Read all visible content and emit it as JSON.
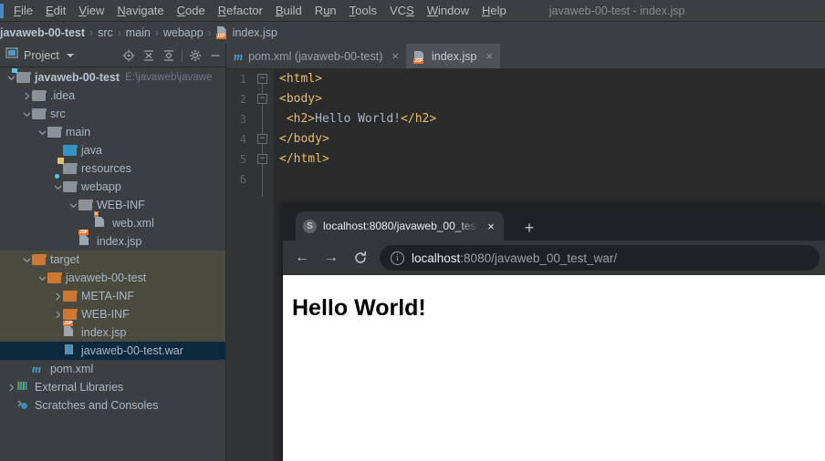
{
  "ide": {
    "window_title": "javaweb-00-test - index.jsp",
    "menu_items": [
      {
        "label": "File",
        "mnemonic": "F"
      },
      {
        "label": "Edit",
        "mnemonic": "E"
      },
      {
        "label": "View",
        "mnemonic": "V"
      },
      {
        "label": "Navigate",
        "mnemonic": "N"
      },
      {
        "label": "Code",
        "mnemonic": "C"
      },
      {
        "label": "Refactor",
        "mnemonic": "R"
      },
      {
        "label": "Build",
        "mnemonic": "B"
      },
      {
        "label": "Run",
        "mnemonic": "u"
      },
      {
        "label": "Tools",
        "mnemonic": "T"
      },
      {
        "label": "VCS",
        "mnemonic": "S"
      },
      {
        "label": "Window",
        "mnemonic": "W"
      },
      {
        "label": "Help",
        "mnemonic": "H"
      }
    ],
    "breadcrumb": {
      "items": [
        "javaweb-00-test",
        "src",
        "main",
        "webapp",
        "index.jsp"
      ],
      "separator": "›"
    },
    "project_panel": {
      "title": "Project",
      "toolbar_icons": [
        "locate-icon",
        "expand-all-icon",
        "collapse-all-icon",
        "settings-gear-icon",
        "hide-icon"
      ],
      "tree": [
        {
          "label": "javaweb-00-test",
          "sub": "E:\\javaweb\\javawe",
          "depth": 0,
          "arrow": "down",
          "icon": "module-folder",
          "bold": true,
          "state": "normal"
        },
        {
          "label": ".idea",
          "sub": "",
          "depth": 1,
          "arrow": "right",
          "icon": "folder-grey",
          "bold": false,
          "state": "normal"
        },
        {
          "label": "src",
          "sub": "",
          "depth": 1,
          "arrow": "down",
          "icon": "folder-grey",
          "bold": false,
          "state": "normal"
        },
        {
          "label": "main",
          "sub": "",
          "depth": 2,
          "arrow": "down",
          "icon": "folder-grey",
          "bold": false,
          "state": "normal"
        },
        {
          "label": "java",
          "sub": "",
          "depth": 3,
          "arrow": "none",
          "icon": "folder-blue",
          "bold": false,
          "state": "normal"
        },
        {
          "label": "resources",
          "sub": "",
          "depth": 3,
          "arrow": "none",
          "icon": "folder-resources",
          "bold": false,
          "state": "normal"
        },
        {
          "label": "webapp",
          "sub": "",
          "depth": 3,
          "arrow": "down",
          "icon": "folder-webapp",
          "bold": false,
          "state": "normal"
        },
        {
          "label": "WEB-INF",
          "sub": "",
          "depth": 4,
          "arrow": "down",
          "icon": "folder-grey",
          "bold": false,
          "state": "normal"
        },
        {
          "label": "web.xml",
          "sub": "",
          "depth": 5,
          "arrow": "none",
          "icon": "xml-file",
          "bold": false,
          "state": "normal"
        },
        {
          "label": "index.jsp",
          "sub": "",
          "depth": 4,
          "arrow": "none",
          "icon": "jsp-file",
          "bold": false,
          "state": "normal"
        },
        {
          "label": "target",
          "sub": "",
          "depth": 1,
          "arrow": "down",
          "icon": "folder-orange",
          "bold": false,
          "state": "excluded"
        },
        {
          "label": "javaweb-00-test",
          "sub": "",
          "depth": 2,
          "arrow": "down",
          "icon": "folder-orange",
          "bold": false,
          "state": "excluded"
        },
        {
          "label": "META-INF",
          "sub": "",
          "depth": 3,
          "arrow": "right",
          "icon": "folder-orange",
          "bold": false,
          "state": "excluded"
        },
        {
          "label": "WEB-INF",
          "sub": "",
          "depth": 3,
          "arrow": "right",
          "icon": "folder-orange",
          "bold": false,
          "state": "excluded"
        },
        {
          "label": "index.jsp",
          "sub": "",
          "depth": 3,
          "arrow": "none",
          "icon": "jsp-file",
          "bold": false,
          "state": "excluded"
        },
        {
          "label": "javaweb-00-test.war",
          "sub": "",
          "depth": 3,
          "arrow": "none",
          "icon": "war-archive",
          "bold": false,
          "state": "selected"
        },
        {
          "label": "pom.xml",
          "sub": "",
          "depth": 1,
          "arrow": "none",
          "icon": "maven-file",
          "bold": false,
          "state": "normal"
        },
        {
          "label": "External Libraries",
          "sub": "",
          "depth": 0,
          "arrow": "right",
          "icon": "libraries",
          "bold": false,
          "state": "normal"
        },
        {
          "label": "Scratches and Consoles",
          "sub": "",
          "depth": 0,
          "arrow": "none",
          "icon": "scratches",
          "bold": false,
          "state": "normal"
        }
      ]
    },
    "editor": {
      "tabs": [
        {
          "label": "pom.xml (javaweb-00-test)",
          "icon": "maven-file",
          "active": false,
          "close": "×"
        },
        {
          "label": "index.jsp",
          "icon": "jsp-file",
          "active": true,
          "close": "×"
        }
      ],
      "line_numbers": [
        "1",
        "2",
        "3",
        "4",
        "5",
        "6"
      ],
      "lines": [
        {
          "pre": "",
          "tag1": "<html>",
          "text": "",
          "tag2": ""
        },
        {
          "pre": "",
          "tag1": "<body>",
          "text": "",
          "tag2": ""
        },
        {
          "pre": " ",
          "tag1": "<h2>",
          "text": "Hello World!",
          "tag2": "</h2>"
        },
        {
          "pre": "",
          "tag1": "</body>",
          "text": "",
          "tag2": ""
        },
        {
          "pre": "",
          "tag1": "</html>",
          "text": "",
          "tag2": ""
        },
        {
          "pre": "",
          "tag1": "",
          "text": "",
          "tag2": ""
        }
      ]
    }
  },
  "browser": {
    "tab": {
      "title": "localhost:8080/javaweb_00_tes",
      "favicon": "globe-icon",
      "close": "×"
    },
    "new_tab_label": "+",
    "nav": {
      "back": "←",
      "forward": "→",
      "reload": "⟳"
    },
    "omnibox": {
      "info_icon": "i",
      "url_host": "localhost",
      "url_rest": ":8080/javaweb_00_test_war/"
    },
    "page": {
      "heading": "Hello World!"
    }
  },
  "colors": {
    "ide_bg": "#3c3f41",
    "editor_bg": "#2b2b2b",
    "gutter_bg": "#313335",
    "accent_orange": "#cc7832",
    "tag_yellow": "#e8bf6a",
    "text_grey": "#a9b7c6",
    "selection_blue": "#0d293e",
    "excluded_olive": "#4b4a3f",
    "chrome_dark": "#202124",
    "chrome_toolbar": "#35363a"
  }
}
